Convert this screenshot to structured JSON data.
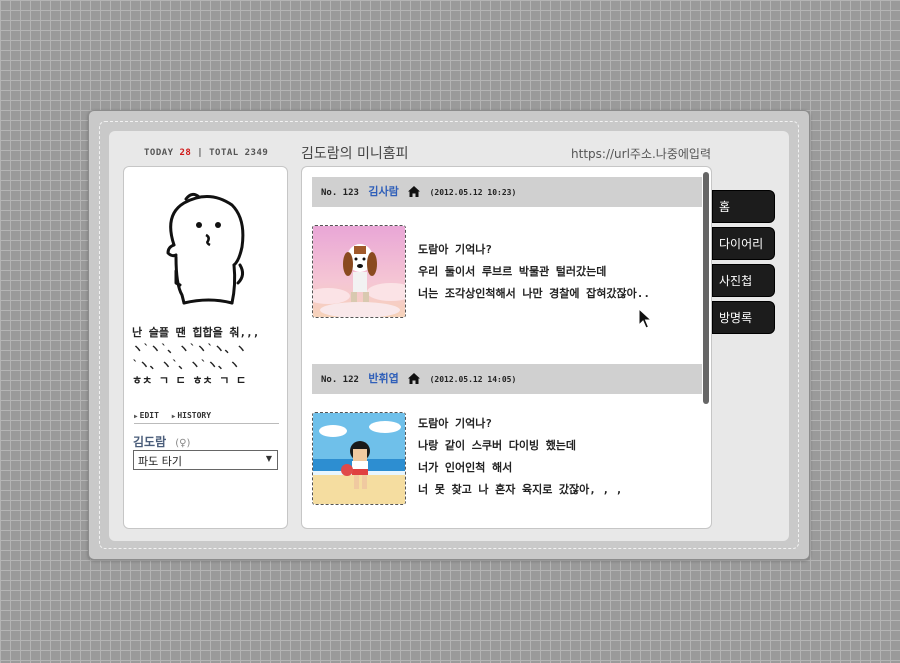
{
  "counter": {
    "today_label": "TODAY",
    "today_value": "28",
    "separator": "|",
    "total_label": "TOTAL",
    "total_value": "2349"
  },
  "header": {
    "title": "김도람의 미니홈피",
    "url": "https://url주소.나중에입력"
  },
  "profile": {
    "status_lines": [
      "난 슬플 땐 힙합을 춰,,,",
      "ヽ`ヽ`、ヽ`ヽ`ヽ、ヽ",
      "`ヽ、ヽ`、ヽ`ヽ、ヽ",
      "ㅎㅊ ㄱ ㄷ ㅎㅊ ㄱ ㄷ"
    ],
    "edit_label": "EDIT",
    "history_label": "HISTORY",
    "name": "김도람",
    "gender": "(♀)",
    "mood_select": "파도 타기"
  },
  "entries": [
    {
      "number": "No. 123",
      "author": "김사람",
      "date": "(2012.05.12 10:23)",
      "lines": [
        "도람아 기억나?",
        "우리 둘이서 루브르 박물관 털러갔는데",
        "너는 조각상인척해서 나만 경찰에 잡혀갔잖아.."
      ]
    },
    {
      "number": "No. 122",
      "author": "반휘엽",
      "date": "(2012.05.12 14:05)",
      "lines": [
        "도람아 기억나?",
        "나랑 같이 스쿠버 다이빙 했는데",
        "너가 인어인척 해서",
        "너 못 찾고 나 혼자 육지로 갔잖아, , ,"
      ]
    }
  ],
  "tabs": [
    "홈",
    "다이어리",
    "사진첩",
    "방명록"
  ]
}
